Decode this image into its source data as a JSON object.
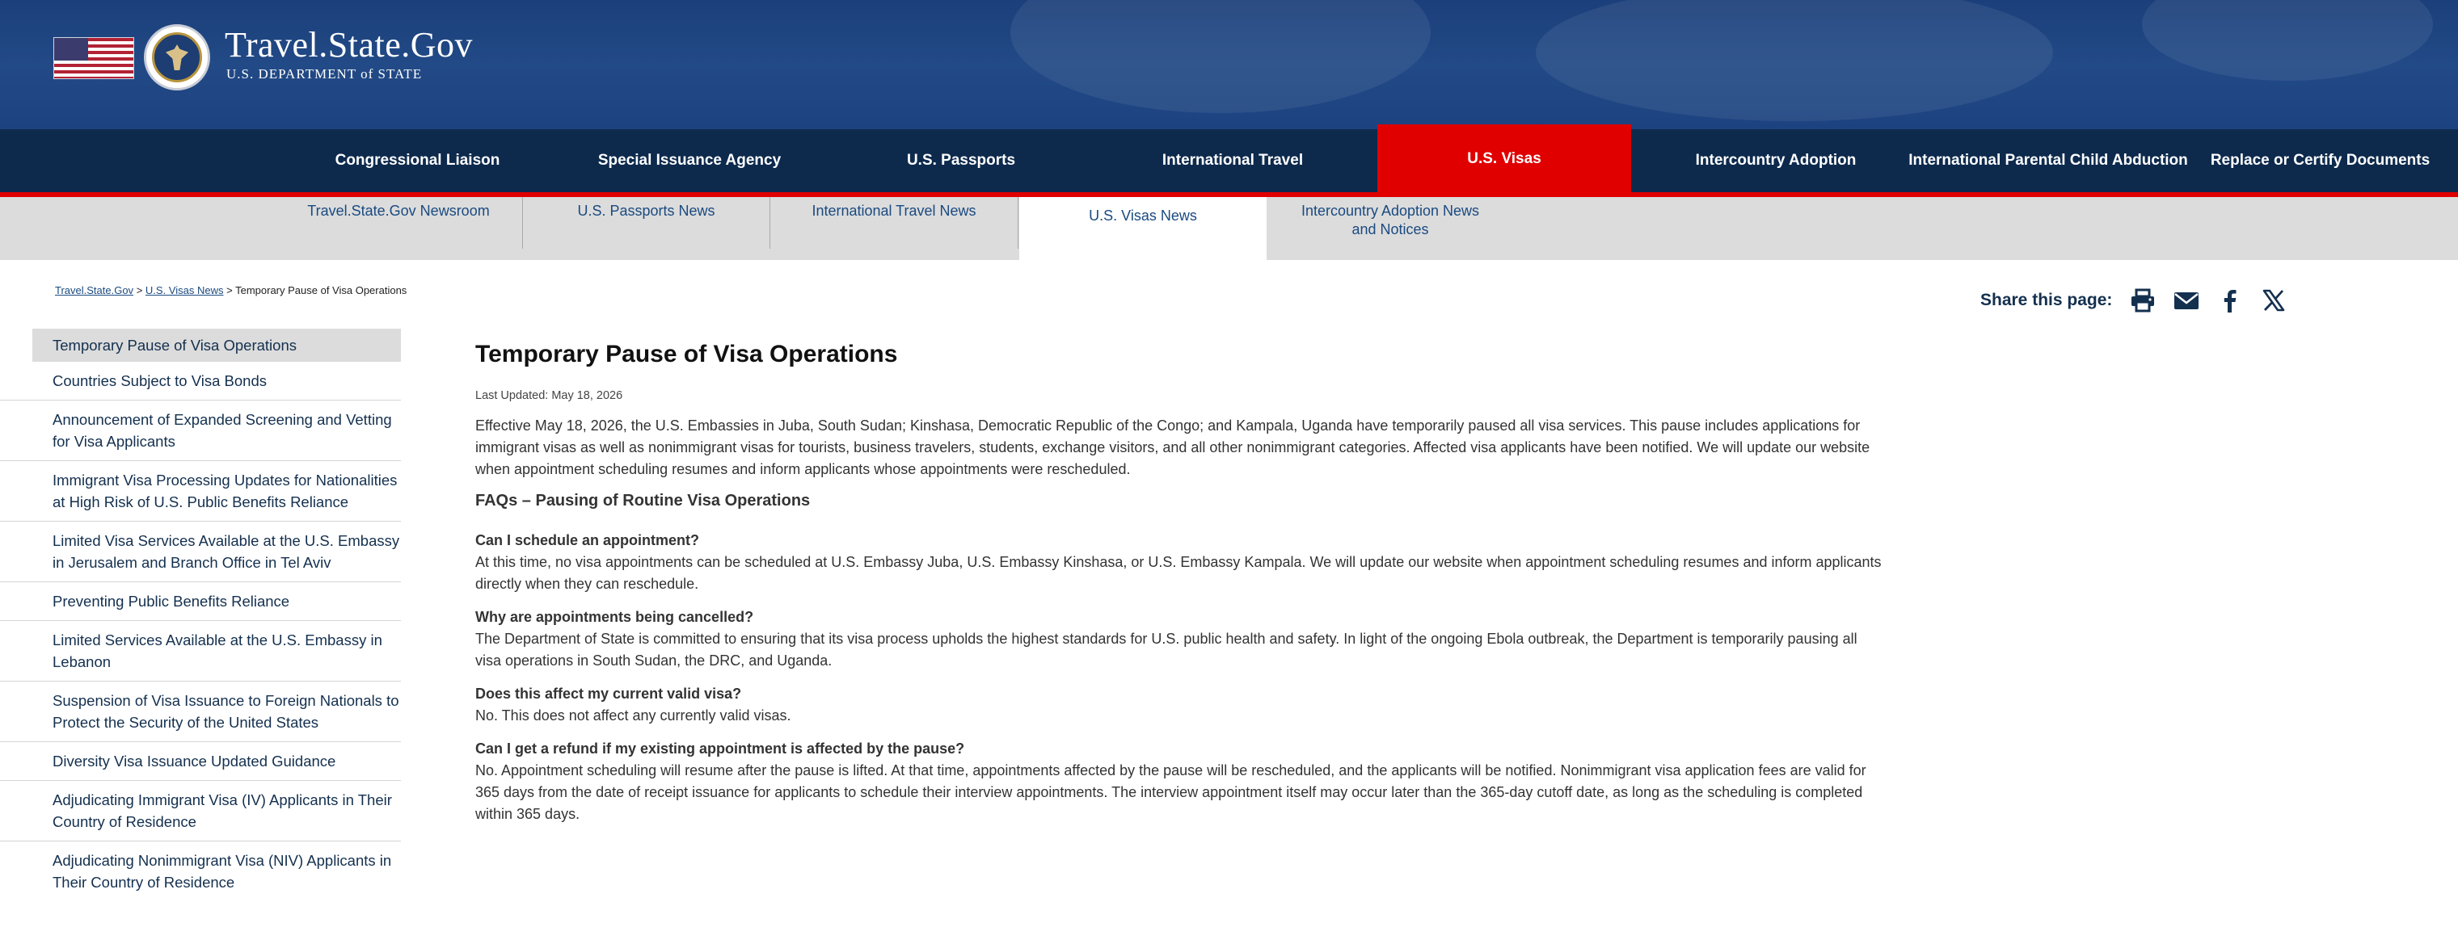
{
  "header": {
    "site_title": "Travel.State.Gov",
    "site_subtitle": "U.S. DEPARTMENT of STATE"
  },
  "main_nav": {
    "items": [
      {
        "label": "Congressional Liaison"
      },
      {
        "label": "Special Issuance Agency"
      },
      {
        "label": "U.S. Passports"
      },
      {
        "label": "International Travel"
      },
      {
        "label": "U.S. Visas",
        "active": true
      },
      {
        "label": "Intercountry Adoption"
      },
      {
        "label": "International Parental Child Abduction"
      },
      {
        "label": "Replace or Certify Documents"
      }
    ]
  },
  "sub_nav": {
    "items": [
      {
        "label": "Travel.State.Gov Newsroom"
      },
      {
        "label": "U.S. Passports News"
      },
      {
        "label": "International Travel News"
      },
      {
        "label": "U.S. Visas News",
        "active": true
      },
      {
        "label": "Intercountry Adoption News and Notices"
      }
    ]
  },
  "breadcrumb": {
    "items": [
      "Travel.State.Gov",
      "U.S. Visas News"
    ],
    "separator": ">",
    "current": "Temporary Pause of Visa Operations"
  },
  "share": {
    "label": "Share this page:",
    "icons": [
      "print-icon",
      "email-icon",
      "facebook-icon",
      "x-icon"
    ]
  },
  "left_nav": {
    "items": [
      {
        "label": "Temporary Pause of Visa Operations",
        "active": true
      },
      {
        "label": "Countries Subject to Visa Bonds"
      },
      {
        "label": "Announcement of Expanded Screening and Vetting for Visa Applicants"
      },
      {
        "label": "Immigrant Visa Processing Updates for Nationalities at High Risk of U.S. Public Benefits Reliance"
      },
      {
        "label": "Limited Visa Services Available at the U.S. Embassy in Jerusalem and Branch Office in Tel Aviv"
      },
      {
        "label": "Preventing Public Benefits Reliance"
      },
      {
        "label": "Limited Services Available at the U.S. Embassy in Lebanon"
      },
      {
        "label": "Suspension of Visa Issuance to Foreign Nationals to Protect the Security of the United States"
      },
      {
        "label": "Diversity Visa Issuance Updated Guidance"
      },
      {
        "label": "Adjudicating Immigrant Visa (IV) Applicants in Their Country of Residence"
      },
      {
        "label": "Adjudicating Nonimmigrant Visa (NIV) Applicants in Their Country of Residence"
      }
    ]
  },
  "article": {
    "title": "Temporary Pause of Visa Operations",
    "last_updated": "Last Updated: May 18, 2026",
    "intro": "Effective May 18, 2026, the U.S. Embassies in Juba, South Sudan; Kinshasa, Democratic Republic of the Congo; and Kampala, Uganda have temporarily paused all visa services.  This pause includes applications for immigrant visas as well as nonimmigrant visas for tourists, business travelers, students, exchange visitors, and all other nonimmigrant categories.  Affected visa applicants have been notified.  We will update our website when appointment scheduling resumes and inform applicants whose appointments were rescheduled.",
    "faq_heading": "FAQs – Pausing of Routine Visa Operations",
    "faqs": [
      {
        "q": "Can I schedule an appointment?",
        "a": "At this time, no visa appointments can be scheduled at U.S. Embassy Juba, U.S. Embassy Kinshasa, or U.S. Embassy Kampala.  We will update our website when appointment scheduling resumes and inform applicants directly when they can reschedule."
      },
      {
        "q": "Why are appointments being cancelled?",
        "a": "The Department of State is committed to ensuring that its visa process upholds the highest standards for U.S. public health and safety.  In light of the ongoing Ebola outbreak, the Department is temporarily pausing all visa operations in South Sudan, the DRC, and Uganda."
      },
      {
        "q": "Does this affect my current valid visa?",
        "a": "No.  This does not affect any currently valid visas."
      },
      {
        "q": "Can I get a refund if my existing appointment is affected by the pause?",
        "a": "No.  Appointment scheduling will resume after the pause is lifted. At that time, appointments affected by the pause will be rescheduled, and the applicants will be notified.  Nonimmigrant visa application fees are valid for 365 days from the date of receipt issuance for applicants to schedule their interview appointments.  The interview appointment itself may occur later than the 365-day cutoff date, as long as the scheduling is completed within 365 days."
      }
    ]
  },
  "colors": {
    "header_blue": "#1d4280",
    "nav_navy": "#0d2a4d",
    "active_red": "#e00000",
    "subnav_gray": "#dcdcdc",
    "link_blue": "#1a4a80"
  }
}
